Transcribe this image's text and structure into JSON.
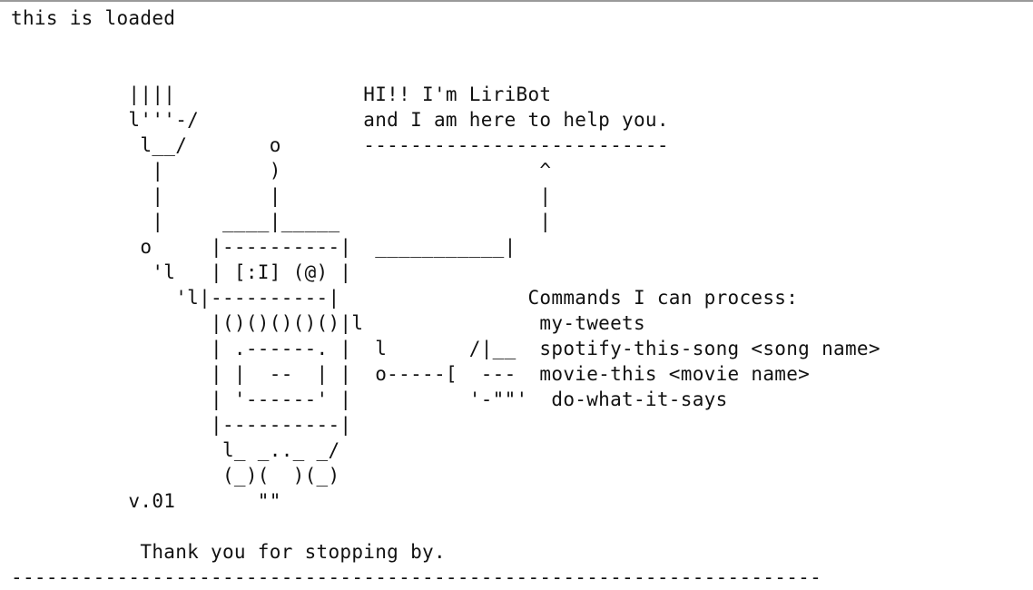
{
  "terminal": {
    "lines": [
      "this is loaded",
      "",
      "",
      "          ||||                HI!! I'm LiriBot",
      "          l'''-/              and I am here to help you.",
      "           l__/       o       --------------------------",
      "            |         )                      ^",
      "            |         |                      |",
      "            |     ____|_____                 |",
      "           o     |----------|  ___________|",
      "            'l   | [:I] (@) |",
      "              'l|----------|                Commands I can process:",
      "                 |()()()()()|l               my-tweets",
      "                 | .------. |  l       /|__  spotify-this-song <song name>",
      "                 | |  --  | |  o-----[  ---  movie-this <movie name>",
      "                 | '------' |          '-\"\"'  do-what-it-says",
      "                 |----------|",
      "                  l_ _.._ _/",
      "                  (_)(  )(_)",
      "          v.01       \"\"",
      "",
      "           Thank you for stopping by.",
      "---------------------------------------------------------------------"
    ]
  }
}
